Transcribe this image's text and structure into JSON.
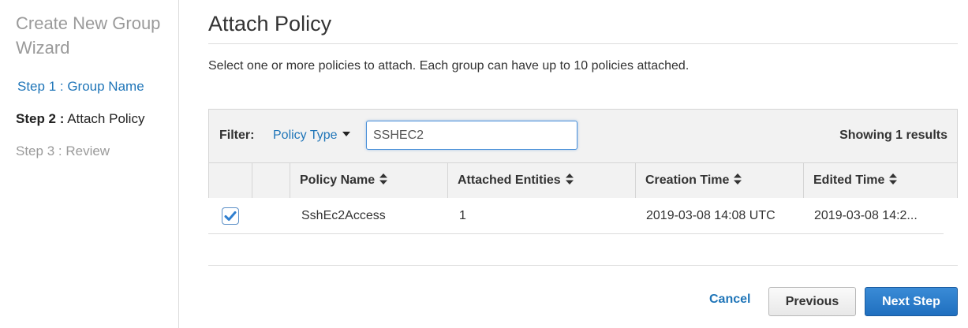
{
  "sidebar": {
    "title": "Create New Group Wizard",
    "steps": [
      {
        "num": "Step 1 :",
        "label": " Group Name"
      },
      {
        "num": "Step 2 :",
        "label": " Attach Policy"
      },
      {
        "num": "Step 3 :",
        "label": " Review"
      }
    ]
  },
  "main": {
    "title": "Attach Policy",
    "description": "Select one or more policies to attach. Each group can have up to 10 policies attached."
  },
  "filter": {
    "label": "Filter:",
    "type_label": "Policy Type",
    "search_value": "SSHEC2",
    "results": "Showing 1 results"
  },
  "table": {
    "columns": [
      "Policy Name",
      "Attached Entities",
      "Creation Time",
      "Edited Time"
    ],
    "rows": [
      {
        "checked": true,
        "policy_name": "SshEc2Access",
        "attached_entities": "1",
        "creation_time": "2019-03-08 14:08 UTC",
        "edited_time": "2019-03-08 14:2..."
      }
    ]
  },
  "footer": {
    "cancel": "Cancel",
    "previous": "Previous",
    "next": "Next Step"
  },
  "colors": {
    "link": "#1f75b8",
    "primary_button": "#1f6fbf"
  }
}
